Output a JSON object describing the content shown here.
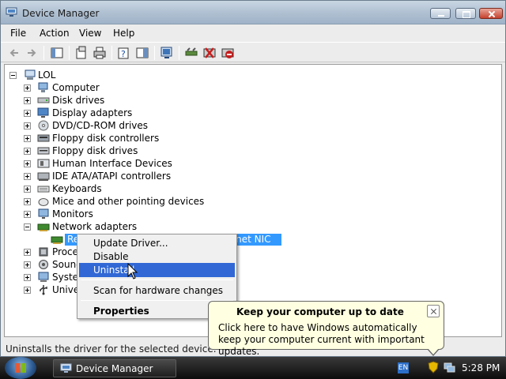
{
  "window": {
    "title": "Device Manager",
    "menu": [
      "File",
      "Action",
      "View",
      "Help"
    ]
  },
  "tree": {
    "root": "LOL",
    "categories": [
      {
        "label": "Computer",
        "icon": "computer-icon"
      },
      {
        "label": "Disk drives",
        "icon": "disk-drive-icon"
      },
      {
        "label": "Display adapters",
        "icon": "display-adapter-icon"
      },
      {
        "label": "DVD/CD-ROM drives",
        "icon": "dvd-icon"
      },
      {
        "label": "Floppy disk controllers",
        "icon": "floppy-controller-icon"
      },
      {
        "label": "Floppy disk drives",
        "icon": "floppy-drive-icon"
      },
      {
        "label": "Human Interface Devices",
        "icon": "hid-icon"
      },
      {
        "label": "IDE ATA/ATAPI controllers",
        "icon": "ide-controller-icon"
      },
      {
        "label": "Keyboards",
        "icon": "keyboard-icon"
      },
      {
        "label": "Mice and other pointing devices",
        "icon": "mouse-icon"
      },
      {
        "label": "Monitors",
        "icon": "monitor-icon"
      },
      {
        "label": "Network adapters",
        "icon": "network-adapter-icon"
      }
    ],
    "selected_child_left": "Re",
    "selected_child_right": "ernet NIC",
    "partial_after": [
      {
        "label": "Proce",
        "icon": "processor-icon"
      },
      {
        "label": "Sound",
        "icon": "sound-icon"
      },
      {
        "label": "Syste",
        "icon": "system-icon"
      },
      {
        "label": "Unive",
        "icon": "usb-icon"
      }
    ]
  },
  "context_menu": {
    "items": [
      "Update Driver...",
      "Disable",
      "Uninstall",
      "Scan for hardware changes",
      "Properties"
    ],
    "highlighted": "Uninstall"
  },
  "status_bar": "Uninstalls the driver for the selected device.",
  "balloon": {
    "title": "Keep your computer up to date",
    "body": "Click here to have Windows automatically keep your computer current with important updates."
  },
  "taskbar": {
    "task": "Device Manager",
    "language": "EN",
    "clock": "5:28 PM"
  },
  "colors": {
    "selection": "#3399ff",
    "menu_highlight": "#3168d5",
    "balloon_bg": "#ffffe1"
  }
}
